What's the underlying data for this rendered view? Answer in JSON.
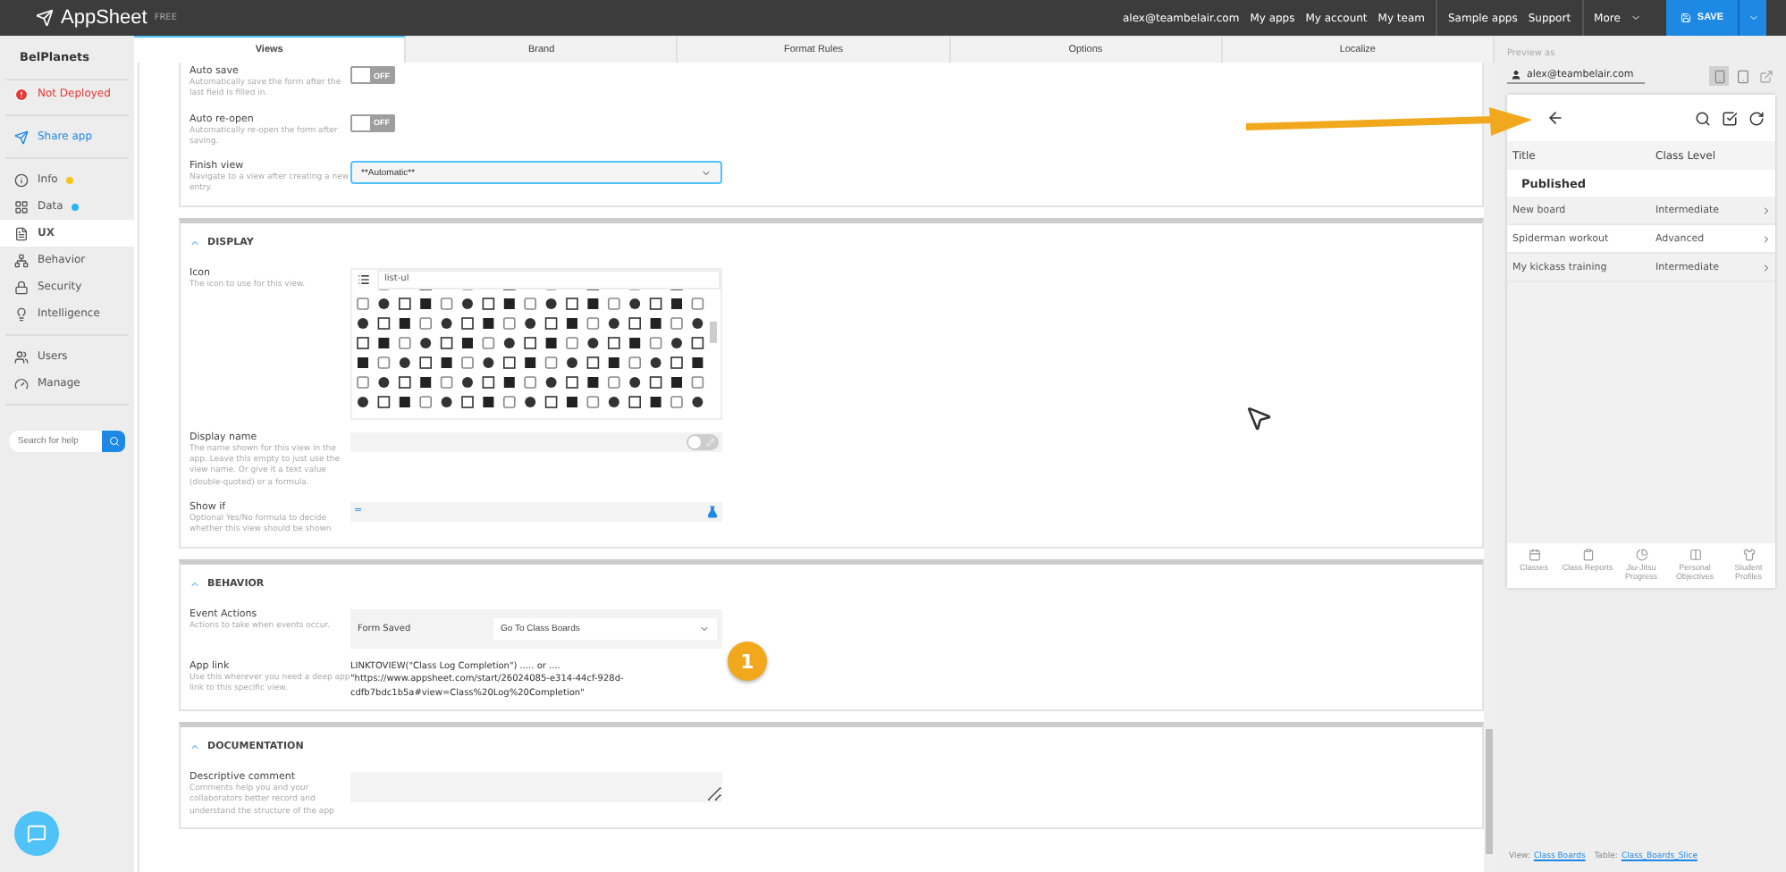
{
  "topbar": {
    "logo": "AppSheet",
    "plan": "FREE",
    "email": "alex@teambelair.com",
    "links": [
      "My apps",
      "My account",
      "My team"
    ],
    "links2": [
      "Sample apps",
      "Support"
    ],
    "more": "More",
    "save": "SAVE"
  },
  "sidebar": {
    "app_name": "BelPlanets",
    "status": "Not Deployed",
    "share": "Share app",
    "items": [
      {
        "label": "Info",
        "selected": false,
        "color": "#f5c518"
      },
      {
        "label": "Data",
        "selected": false,
        "color": "#29b6f6"
      },
      {
        "label": "UX",
        "selected": true
      },
      {
        "label": "Behavior",
        "selected": false
      },
      {
        "label": "Security",
        "selected": false
      },
      {
        "label": "Intelligence",
        "selected": false
      }
    ],
    "items2": [
      {
        "label": "Users",
        "selected": false
      },
      {
        "label": "Manage",
        "selected": false
      }
    ],
    "search": {
      "placeholder": "Search for help"
    }
  },
  "tabs": [
    {
      "label": "Views",
      "selected": true
    },
    {
      "label": "Brand",
      "selected": false
    },
    {
      "label": "Format Rules",
      "selected": false
    },
    {
      "label": "Options",
      "selected": false
    },
    {
      "label": "Localize",
      "selected": false
    }
  ],
  "form_settings": [
    {
      "kind": "toggle",
      "label": "Auto save",
      "description": "Automatically save the form after the last field is filled in.",
      "on": false,
      "state_text": "OFF"
    },
    {
      "kind": "toggle",
      "label": "Auto re-open",
      "description": "Automatically re-open the form after saving.",
      "on": false,
      "state_text": "OFF"
    },
    {
      "kind": "select",
      "label": "Finish view",
      "description": "Navigate to a view after creating a new entry.",
      "value": "**Automatic**"
    }
  ],
  "display": {
    "title": "DISPLAY",
    "icon_label": "Icon",
    "icon_description": "The icon to use for this view.",
    "icon_value": "list-ul",
    "display_name_label": "Display name",
    "display_name_description": "The name shown for this view in the app. Leave this empty to just use the view name. Or give it a text value (double-quoted) or a formula.",
    "display_name_formula": false,
    "show_if_label": "Show if",
    "show_if_description": "Optional Yes/No formula to decide whether this view should be shown",
    "show_if_prefix": "="
  },
  "behavior": {
    "title": "BEHAVIOR",
    "event_label": "Event Actions",
    "event_description": "Actions to take when events occur.",
    "event": "Form Saved",
    "action": "Go To Class Boards",
    "app_link_label": "App link",
    "app_link_description": "Use this wherever you need a deep app link to this specific view.",
    "app_link_lines": [
      "LINKTOVIEW(\"Class Log Completion\") ..... or ....",
      "\"https://www.appsheet.com/start/26024085-e314-44cf-928d-",
      "cdfb7bdc1b5a#view=Class%20Log%20Completion\""
    ]
  },
  "documentation": {
    "title": "DOCUMENTATION",
    "label": "Descriptive comment",
    "description": "Comments help you and your collaborators better record and understand the structure of the app"
  },
  "annotation_badge": "1",
  "preview": {
    "label": "Preview as",
    "user": "alex@teambelair.com",
    "device_mode": [
      {
        "kind": "phone",
        "selected": true
      },
      {
        "kind": "tablet",
        "selected": false
      }
    ],
    "columns": [
      "Title",
      "Class Level"
    ],
    "group": "Published",
    "rows": [
      [
        "New board",
        "Intermediate"
      ],
      [
        "Spiderman workout",
        "Advanced"
      ],
      [
        "My kickass training",
        "Intermediate"
      ]
    ],
    "nav": [
      "Classes",
      "Class Reports",
      "Jiu-Jitsu Progress",
      "Personal Objectives",
      "Student Profiles"
    ],
    "footer": {
      "view_label": "View:",
      "view": "Class Boards",
      "table_label": "Table:",
      "table": "Class_Boards_Slice"
    }
  }
}
